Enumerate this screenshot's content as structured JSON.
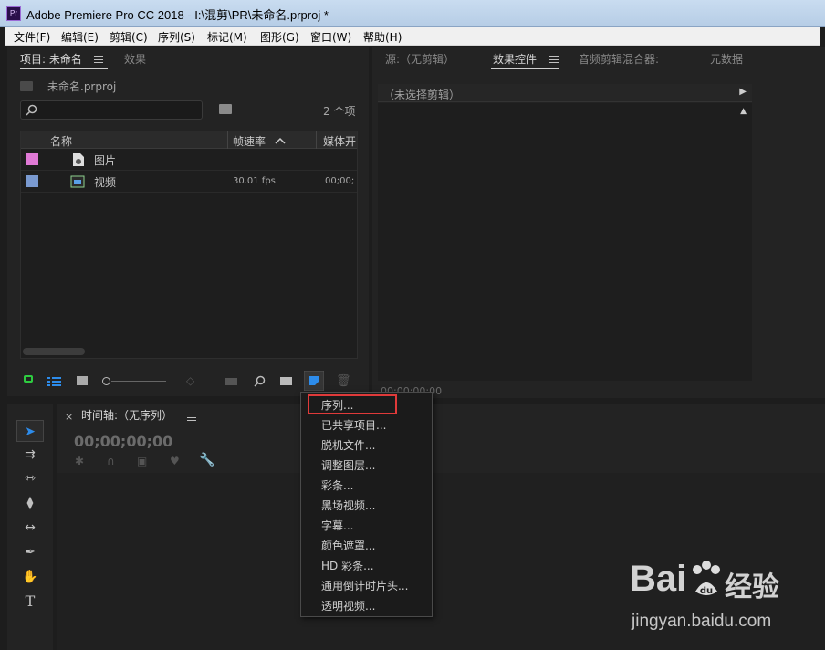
{
  "window": {
    "icon_text": "Pr",
    "title": "Adobe Premiere Pro CC 2018 - I:\\混剪\\PR\\未命名.prproj *"
  },
  "menu": [
    "文件(F)",
    "编辑(E)",
    "剪辑(C)",
    "序列(S)",
    "标记(M)",
    "图形(G)",
    "窗口(W)",
    "帮助(H)"
  ],
  "project_panel": {
    "tabs": [
      "项目: 未命名",
      "效果"
    ],
    "file_name": "未命名.prproj",
    "item_count": "2 个项",
    "columns": [
      "名称",
      "帧速率",
      "媒体开"
    ],
    "rows": [
      {
        "color": "#e07ad6",
        "name": "图片",
        "fps": "",
        "media": ""
      },
      {
        "color": "#7a9ad0",
        "name": "视频",
        "fps": "30.01 fps",
        "media": "00;00;"
      }
    ]
  },
  "source_panel": {
    "tabs": [
      "源:（无剪辑）",
      "效果控件",
      "音频剪辑混合器:",
      "元数据"
    ],
    "no_clip": "（未选择剪辑）",
    "timecode": "00:00:00:00"
  },
  "timeline": {
    "tab_close": "×",
    "tab_label": "时间轴:（无序列）",
    "timecode": "00;00;00;00"
  },
  "new_item_menu": {
    "items": [
      "序列...",
      "已共享项目...",
      "脱机文件...",
      "调整图层...",
      "彩条...",
      "黑场视频...",
      "字幕...",
      "颜色遮罩...",
      "HD 彩条...",
      "通用倒计时片头...",
      "透明视频..."
    ],
    "highlighted_index": 0
  },
  "watermark": {
    "brand": "Bai",
    "brand_suffix": "经验",
    "url": "jingyan.baidu.com"
  },
  "colors": {
    "accent_blue": "#2d8ceb",
    "highlight_red": "#e03a3a",
    "lock_green": "#2ecc40"
  }
}
